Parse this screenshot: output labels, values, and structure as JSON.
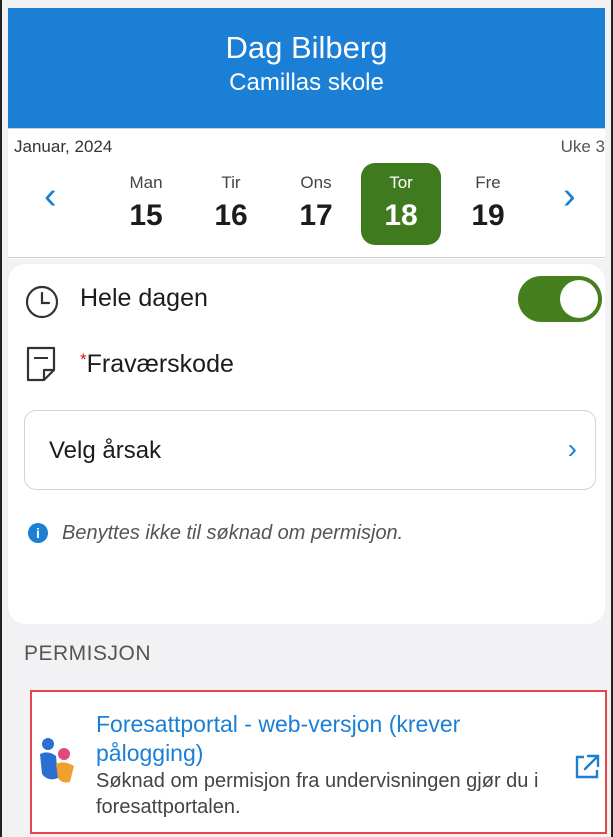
{
  "header": {
    "name": "Dag Bilberg",
    "school": "Camillas skole"
  },
  "calendar": {
    "month": "Januar, 2024",
    "week": "Uke 3",
    "days": [
      {
        "name": "Man",
        "date": "15"
      },
      {
        "name": "Tir",
        "date": "16"
      },
      {
        "name": "Ons",
        "date": "17"
      },
      {
        "name": "Tor",
        "date": "18"
      },
      {
        "name": "Fre",
        "date": "19"
      }
    ],
    "selected_index": 3
  },
  "form": {
    "all_day_label": "Hele dagen",
    "all_day_on": true,
    "absence_code_star": "*",
    "absence_code_label": "Fraværskode",
    "reason_placeholder": "Velg årsak",
    "info_text": "Benyttes ikke til søknad om permisjon."
  },
  "permission": {
    "section_title": "PERMISJON",
    "link_title": "Foresattportal - web-versjon (krever pålogging)",
    "link_desc": "Søknad om permisjon fra undervisningen gjør du i foresattportalen."
  },
  "colors": {
    "accent": "#1c7fd6",
    "selected_green": "#3f7a1e",
    "highlight": "#e5474f"
  }
}
